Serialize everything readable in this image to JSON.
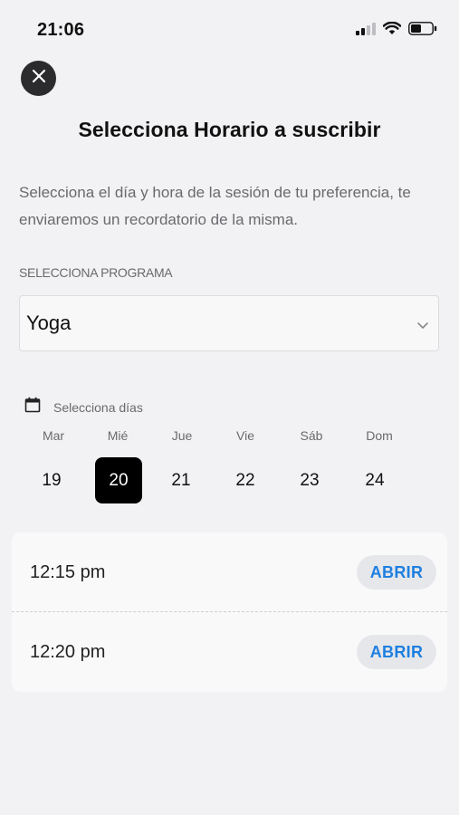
{
  "status_bar": {
    "time": "21:06",
    "icons": [
      "cellular-signal-icon",
      "wifi-icon",
      "battery-icon"
    ]
  },
  "close_button": {
    "icon": "close-icon"
  },
  "title": "Selecciona Horario a suscribir",
  "description": "Selecciona el día y hora de la sesión de tu preferencia, te enviaremos un recordatorio de la misma.",
  "program": {
    "label": "SELECCIONA PROGRAMA",
    "selected": "Yoga"
  },
  "days": {
    "label": "Selecciona días",
    "weekdays": [
      "Mar",
      "Mié",
      "Jue",
      "Vie",
      "Sáb",
      "Dom"
    ],
    "dates": [
      "19",
      "20",
      "21",
      "22",
      "23",
      "24"
    ],
    "selected_date": "20"
  },
  "slots": [
    {
      "time": "12:15 pm",
      "action": "ABRIR"
    },
    {
      "time": "12:20 pm",
      "action": "ABRIR"
    }
  ],
  "colors": {
    "background": "#f2f2f4",
    "accent": "#1f7fe0",
    "selected_day": "#000000"
  }
}
